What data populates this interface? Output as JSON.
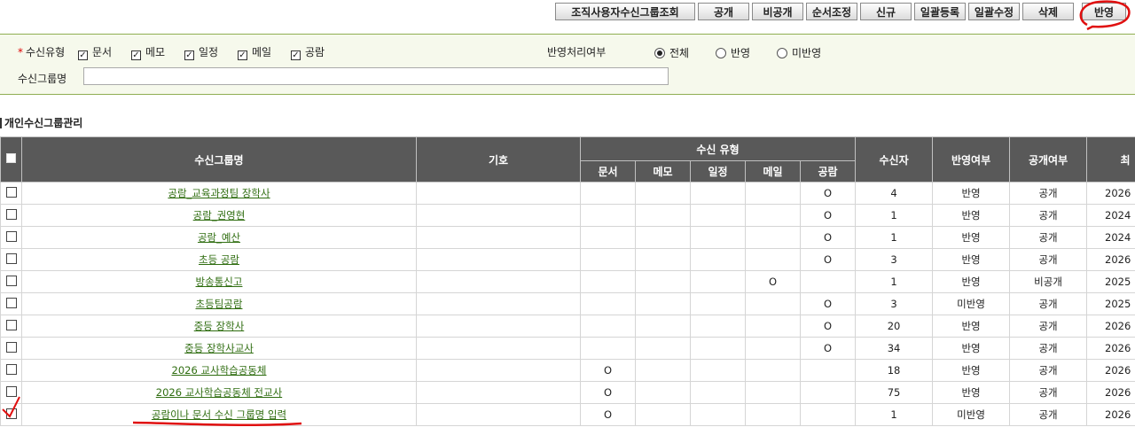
{
  "toolbar": {
    "buttons": [
      "조직사용자수신그룹조회",
      "공개",
      "비공개",
      "순서조정",
      "신규",
      "일괄등록",
      "일괄수정",
      "삭제",
      "반영"
    ]
  },
  "search": {
    "type_label": "수신유형",
    "required_mark": "*",
    "types": [
      {
        "label": "문서",
        "checked": true
      },
      {
        "label": "메모",
        "checked": true
      },
      {
        "label": "일정",
        "checked": true
      },
      {
        "label": "메일",
        "checked": true
      },
      {
        "label": "공람",
        "checked": true
      }
    ],
    "apply_label": "반영처리여부",
    "apply_options": [
      {
        "label": "전체",
        "selected": true
      },
      {
        "label": "반영",
        "selected": false
      },
      {
        "label": "미반영",
        "selected": false
      }
    ],
    "group_name_label": "수신그룹명",
    "group_name_value": ""
  },
  "section_title": "개인수신그룹관리",
  "table": {
    "headers": {
      "name": "수신그룹명",
      "symbol": "기호",
      "type_group": "수신 유형",
      "types": [
        "문서",
        "메모",
        "일정",
        "메일",
        "공람"
      ],
      "recipients": "수신자",
      "applied": "반영여부",
      "public": "공개여부",
      "last": "최"
    },
    "rows": [
      {
        "name": "공람_교육과정팀 장학사",
        "doc": "",
        "memo": "",
        "sched": "",
        "mail": "",
        "gongram": "O",
        "count": "4",
        "applied": "반영",
        "public": "공개",
        "date": "2026"
      },
      {
        "name": "공람_권영현",
        "doc": "",
        "memo": "",
        "sched": "",
        "mail": "",
        "gongram": "O",
        "count": "1",
        "applied": "반영",
        "public": "공개",
        "date": "2024"
      },
      {
        "name": "공람_예산",
        "doc": "",
        "memo": "",
        "sched": "",
        "mail": "",
        "gongram": "O",
        "count": "1",
        "applied": "반영",
        "public": "공개",
        "date": "2024"
      },
      {
        "name": "초등 공람",
        "doc": "",
        "memo": "",
        "sched": "",
        "mail": "",
        "gongram": "O",
        "count": "3",
        "applied": "반영",
        "public": "공개",
        "date": "2026"
      },
      {
        "name": "방송통신고",
        "doc": "",
        "memo": "",
        "sched": "",
        "mail": "O",
        "gongram": "",
        "count": "1",
        "applied": "반영",
        "public": "비공개",
        "date": "2025"
      },
      {
        "name": "초등팀공람",
        "doc": "",
        "memo": "",
        "sched": "",
        "mail": "",
        "gongram": "O",
        "count": "3",
        "applied": "미반영",
        "public": "공개",
        "date": "2025"
      },
      {
        "name": "중등 장학사",
        "doc": "",
        "memo": "",
        "sched": "",
        "mail": "",
        "gongram": "O",
        "count": "20",
        "applied": "반영",
        "public": "공개",
        "date": "2026"
      },
      {
        "name": "중등 장학사교사",
        "doc": "",
        "memo": "",
        "sched": "",
        "mail": "",
        "gongram": "O",
        "count": "34",
        "applied": "반영",
        "public": "공개",
        "date": "2026"
      },
      {
        "name": "2026 교사학습공동체",
        "doc": "O",
        "memo": "",
        "sched": "",
        "mail": "",
        "gongram": "",
        "count": "18",
        "applied": "반영",
        "public": "공개",
        "date": "2026"
      },
      {
        "name": "2026 교사학습공동체 전교사",
        "doc": "O",
        "memo": "",
        "sched": "",
        "mail": "",
        "gongram": "",
        "count": "75",
        "applied": "반영",
        "public": "공개",
        "date": "2026"
      },
      {
        "name": "공람이나 문서 수신 그룹명 입력",
        "doc": "O",
        "memo": "",
        "sched": "",
        "mail": "",
        "gongram": "",
        "count": "1",
        "applied": "미반영",
        "public": "공개",
        "date": "2026"
      }
    ]
  },
  "annotation_color": "#e01010"
}
